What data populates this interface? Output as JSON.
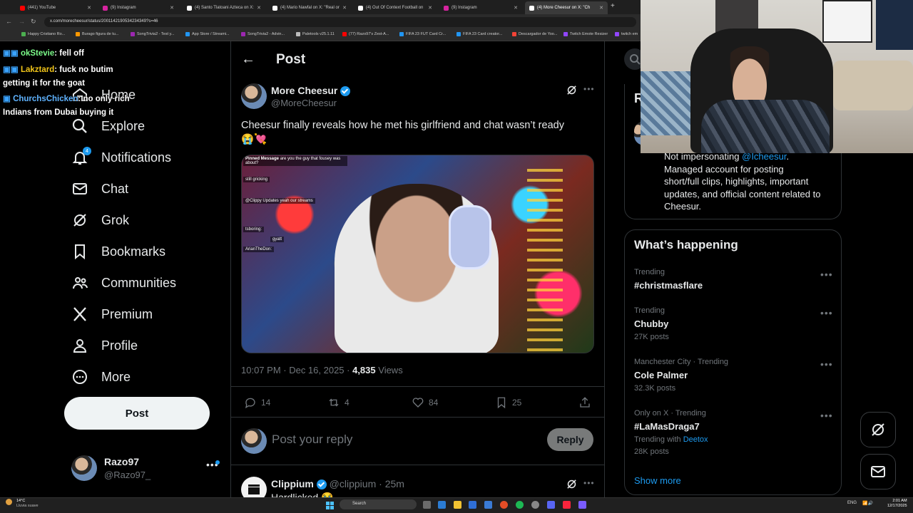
{
  "browser": {
    "tabs": [
      {
        "label": "(441) YouTube",
        "color": "#ff0000"
      },
      {
        "label": "(9) Instagram",
        "color": "#d6249f"
      },
      {
        "label": "(4) Santo Tlatoani Azteca on X:",
        "color": "#ffffff"
      },
      {
        "label": "(4) Mario Nawfal on X: \"Real or",
        "color": "#ffffff"
      },
      {
        "label": "(4) Out Of Context Football on",
        "color": "#ffffff"
      },
      {
        "label": "(9) Instagram",
        "color": "#d6249f"
      },
      {
        "label": "(4) More Cheesur on X: \"Ch",
        "color": "#ffffff"
      }
    ],
    "url": "x.com/morecheesur/status/2001142190534234349?s=46",
    "bookmarks": [
      {
        "label": "Happy Cristiano Ro...",
        "color": "#4caf50"
      },
      {
        "label": "Burago figura de tu...",
        "color": "#ff9800"
      },
      {
        "label": "SongTrivia2 - Test y...",
        "color": "#9c27b0"
      },
      {
        "label": "App Store / Streami...",
        "color": "#2196f3"
      },
      {
        "label": "SongTrivia2 - Advin...",
        "color": "#9c27b0"
      },
      {
        "label": "Paletools v25.1.11",
        "color": "#bbbbbb"
      },
      {
        "label": "(77) Razo97's Zest-A...",
        "color": "#ff0000"
      },
      {
        "label": "FIFA 23 FUT Card Cr...",
        "color": "#2196f3"
      },
      {
        "label": "FIFA 23 Card creator...",
        "color": "#2196f3"
      },
      {
        "label": "Descargador de Yoo...",
        "color": "#f44336"
      },
      {
        "label": "Twitch Emote Resizer",
        "color": "#9146ff"
      },
      {
        "label": "twitch em",
        "color": "#9146ff"
      }
    ]
  },
  "chat": [
    {
      "user": "okStevie",
      "user_color": "#7cfc8a",
      "message": ": fell off"
    },
    {
      "user": "Lakztard",
      "user_color": "#f0c419",
      "message": ": fuck no butim"
    },
    {
      "user": "",
      "user_color": "#ffffff",
      "message": "getting it for the goat"
    },
    {
      "user": "ChurchsChicken",
      "user_color": "#5fb3ff",
      "message": ": no only rich"
    },
    {
      "user": "",
      "user_color": "#ffffff",
      "message": "Indians from Dubai buying it"
    }
  ],
  "nav": {
    "home": "Home",
    "explore": "Explore",
    "notifications": "Notifications",
    "notifications_badge": "4",
    "chat": "Chat",
    "grok": "Grok",
    "bookmarks": "Bookmarks",
    "communities": "Communities",
    "premium": "Premium",
    "profile": "Profile",
    "more": "More",
    "post_button": "Post"
  },
  "account": {
    "name": "Razo97",
    "handle": "@Razo97_"
  },
  "header": {
    "title": "Post"
  },
  "post": {
    "author_name": "More Cheesur",
    "author_handle": "@MoreCheesur",
    "text": "Cheesur finally reveals how he met his girlfriend and chat wasn’t ready",
    "emojis": "😭💘",
    "timestamp": "10:07 PM · Dec 16, 2025 · ",
    "views_count": "4,835",
    "views_label": " Views",
    "replies": "14",
    "reposts": "4",
    "likes": "84",
    "bookmarks": "25"
  },
  "video_overlay": {
    "pinned": "Pinned Message",
    "pinned_text": "are you the guy that fousey was about?",
    "lines": [
      "still gricking",
      "@Clippy Updates yeah our streams",
      "tsboring:",
      "gyatt",
      "ArianTheDon:"
    ]
  },
  "reply_box": {
    "placeholder": "Post your reply",
    "button": "Reply"
  },
  "next_reply": {
    "name": "Clippium",
    "handle": "@clippium",
    "time": "· 25m",
    "preview": "Hardlicked 😭"
  },
  "bio": {
    "mention": "@Icheesur",
    "line1_prefix": "Not impersonating ",
    "line1_suffix": ".",
    "line2": "Managed account for posting",
    "line3": "short/full clips, highlights, important",
    "line4": "updates, and official content related to",
    "line5": "Cheesur."
  },
  "happening": {
    "title": "What’s happening",
    "trends": [
      {
        "meta": "Trending",
        "name": "#christmasflare",
        "posts": ""
      },
      {
        "meta": "Trending",
        "name": "Chubby",
        "posts": "27K posts"
      },
      {
        "meta": "Manchester City · Trending",
        "name": "Cole Palmer",
        "posts": "32.3K posts"
      },
      {
        "meta": "Only on X · Trending",
        "name": "#LaMasDraga7",
        "posts": "28K posts",
        "with_prefix": "Trending with ",
        "with_link": "Deetox"
      }
    ],
    "show_more": "Show more"
  },
  "taskbar": {
    "weather_temp": "14°C",
    "weather_desc": "Lluvia suave",
    "search": "Search",
    "lang": "ENG",
    "time": "2:01 AM",
    "date": "12/17/2025"
  },
  "colors": {
    "accent": "#1d9bf0",
    "background": "#000000",
    "border": "#2f3336",
    "muted": "#71767b"
  }
}
